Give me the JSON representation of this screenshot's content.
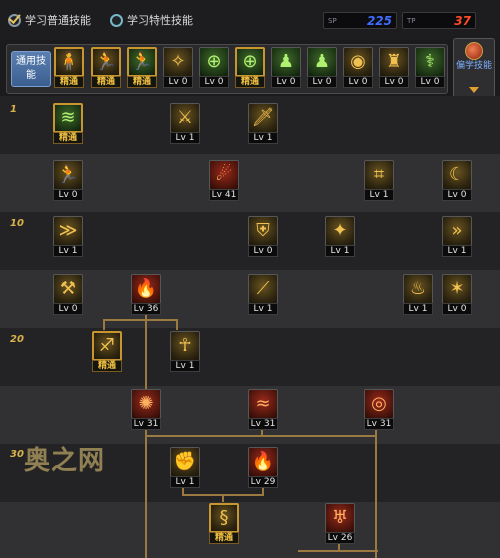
{
  "topbar": {
    "option_general": "学习普通技能",
    "option_special": "学习特性技能",
    "sp_general": "225",
    "sp_special": "37",
    "sp_general_color": "#3d6cff",
    "sp_special_color": "#ff4a2a"
  },
  "hotbar": {
    "label": "通用技能",
    "items": [
      {
        "tag": "精通",
        "master": true,
        "icon": "figure-icon",
        "glyph": "🧍",
        "color": "gold"
      },
      {
        "tag": "精通",
        "master": true,
        "icon": "crouch-icon",
        "glyph": "🏃",
        "color": "gold"
      },
      {
        "tag": "精通",
        "master": true,
        "icon": "dash-icon",
        "glyph": "🏃",
        "color": "green"
      },
      {
        "tag": "Lv 0",
        "master": false,
        "icon": "wings-icon",
        "glyph": "✧",
        "color": "gold"
      },
      {
        "tag": "Lv 0",
        "master": false,
        "icon": "crosshair-icon",
        "glyph": "⊕",
        "color": "green"
      },
      {
        "tag": "精通",
        "master": true,
        "icon": "crosshair-icon",
        "glyph": "⊕",
        "color": "green"
      },
      {
        "tag": "Lv 0",
        "master": false,
        "icon": "figure-icon",
        "glyph": "♟",
        "color": "green"
      },
      {
        "tag": "Lv 0",
        "master": false,
        "icon": "figure-icon",
        "glyph": "♟",
        "color": "green"
      },
      {
        "tag": "Lv 0",
        "master": false,
        "icon": "eye-icon",
        "glyph": "◉",
        "color": "gold"
      },
      {
        "tag": "Lv 0",
        "master": false,
        "icon": "figure-icon",
        "glyph": "♜",
        "color": "gold"
      },
      {
        "tag": "Lv 0",
        "master": false,
        "icon": "leap-icon",
        "glyph": "⚕",
        "color": "green"
      }
    ]
  },
  "learn_button": {
    "label": "偏学技能"
  },
  "level_markers": [
    "1",
    "10",
    "20",
    "30"
  ],
  "skills": [
    {
      "tag": "精通",
      "master": true,
      "icon": "claw-icon",
      "glyph": "≋",
      "color": "green"
    },
    {
      "tag": "Lv 1",
      "master": false,
      "icon": "dagger-icon",
      "glyph": "⚔",
      "color": "gold"
    },
    {
      "tag": "Lv 1",
      "master": false,
      "icon": "sword-icon",
      "glyph": "🗡",
      "color": "gold"
    },
    {
      "tag": "Lv 0",
      "master": false,
      "icon": "runner-icon",
      "glyph": "🏃",
      "color": "gold"
    },
    {
      "tag": "Lv 41",
      "master": false,
      "icon": "fireball-icon",
      "glyph": "☄",
      "color": "red"
    },
    {
      "tag": "Lv 1",
      "master": false,
      "icon": "stairs-icon",
      "glyph": "⌗",
      "color": "gold"
    },
    {
      "tag": "Lv 0",
      "master": false,
      "icon": "crescent-icon",
      "glyph": "☾",
      "color": "gold"
    },
    {
      "tag": "Lv 1",
      "master": false,
      "icon": "slash-icon",
      "glyph": "≫",
      "color": "gold"
    },
    {
      "tag": "Lv 0",
      "master": false,
      "icon": "shield-icon",
      "glyph": "⛨",
      "color": "gold"
    },
    {
      "tag": "Lv 1",
      "master": false,
      "icon": "kick-icon",
      "glyph": "✦",
      "color": "gold"
    },
    {
      "tag": "Lv 1",
      "master": false,
      "icon": "arrows-icon",
      "glyph": "»",
      "color": "gold"
    },
    {
      "tag": "Lv 0",
      "master": false,
      "icon": "sword-icon",
      "glyph": "⚒",
      "color": "gold"
    },
    {
      "tag": "Lv 36",
      "master": false,
      "icon": "fire-icon",
      "glyph": "🔥",
      "color": "red"
    },
    {
      "tag": "Lv 1",
      "master": false,
      "icon": "blade-icon",
      "glyph": "⟋",
      "color": "gold"
    },
    {
      "tag": "Lv 1",
      "master": false,
      "icon": "flame-figure-icon",
      "glyph": "♨",
      "color": "gold"
    },
    {
      "tag": "Lv 0",
      "master": false,
      "icon": "spike-icon",
      "glyph": "✶",
      "color": "gold"
    },
    {
      "tag": "精通",
      "master": true,
      "icon": "wing-icon",
      "glyph": "♐",
      "color": "gold"
    },
    {
      "tag": "Lv 1",
      "master": false,
      "icon": "warrior-icon",
      "glyph": "☥",
      "color": "gold"
    },
    {
      "tag": "Lv 31",
      "master": false,
      "icon": "burst-icon",
      "glyph": "✺",
      "color": "red"
    },
    {
      "tag": "Lv 31",
      "master": false,
      "icon": "claws-icon",
      "glyph": "≈",
      "color": "red"
    },
    {
      "tag": "Lv 31",
      "master": false,
      "icon": "vortex-icon",
      "glyph": "◎",
      "color": "red"
    },
    {
      "tag": "Lv 1",
      "master": false,
      "icon": "fist-icon",
      "glyph": "✊",
      "color": "gold"
    },
    {
      "tag": "Lv 29",
      "master": false,
      "icon": "flame-swipe-icon",
      "glyph": "🔥",
      "color": "red"
    },
    {
      "tag": "精通",
      "master": true,
      "icon": "dragon-icon",
      "glyph": "§",
      "color": "gold"
    },
    {
      "tag": "Lv 26",
      "master": false,
      "icon": "demon-icon",
      "glyph": "♅",
      "color": "red"
    }
  ],
  "watermark": "奥之网"
}
